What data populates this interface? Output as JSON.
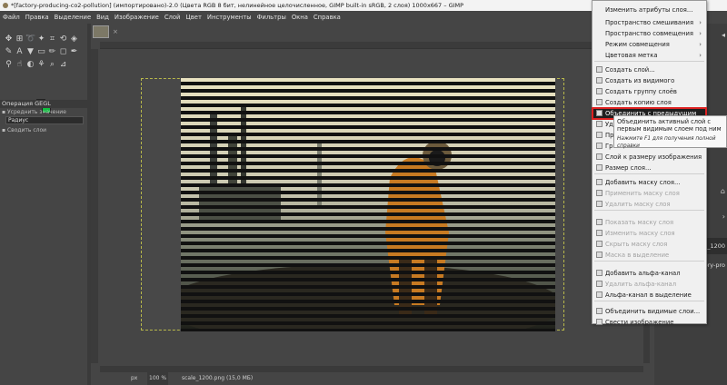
{
  "window": {
    "title": "*[factory-producing-co2-pollution] (импортировано)-2.0 (Цвета RGB 8 бит, нелинейное целочисленное, GIMP built-in sRGB, 2 слоя) 1000x667 – GIMP"
  },
  "menubar": [
    "Файл",
    "Правка",
    "Выделение",
    "Вид",
    "Изображение",
    "Слой",
    "Цвет",
    "Инструменты",
    "Фильтры",
    "Окна",
    "Справка"
  ],
  "tool_options": {
    "title": "Операция GEGL",
    "average_label": "Усреднить значение",
    "radius_value": "Радиус",
    "merge_label": "Сводить слои"
  },
  "image_tab": {
    "close": "×"
  },
  "status": {
    "unit": "px",
    "zoom": "100 %",
    "file": "scale_1200.png (15,0 МБ)"
  },
  "right_dock": {
    "layer1_name": "_1200",
    "layer2_name": "tory-pro"
  },
  "context_menu": {
    "items": [
      {
        "label": "Изменить атрибуты слоя...",
        "disabled": false,
        "submenu": false
      },
      {
        "label": "Пространство смешивания",
        "disabled": false,
        "submenu": true
      },
      {
        "label": "Пространство совмещения",
        "disabled": false,
        "submenu": true
      },
      {
        "label": "Режим совмещения",
        "disabled": false,
        "submenu": true
      },
      {
        "label": "Цветовая метка",
        "disabled": false,
        "submenu": true
      },
      {
        "label": "Создать слой...",
        "disabled": false,
        "submenu": false
      },
      {
        "label": "Создать из видимого",
        "disabled": false,
        "submenu": false
      },
      {
        "label": "Создать группу слоёв",
        "disabled": false,
        "submenu": false
      },
      {
        "label": "Создать копию слоя",
        "disabled": false,
        "submenu": false
      },
      {
        "label": "Объединить с предыдущим",
        "disabled": false,
        "submenu": false
      },
      {
        "label": "Уда",
        "disabled": false,
        "submenu": false
      },
      {
        "label": "Пр",
        "disabled": false,
        "submenu": false
      },
      {
        "label": "Гра",
        "disabled": false,
        "submenu": false
      },
      {
        "label": "Слой к размеру изображения",
        "disabled": false,
        "submenu": false
      },
      {
        "label": "Размер слоя...",
        "disabled": false,
        "submenu": false
      },
      {
        "label": "Добавить маску слоя...",
        "disabled": false,
        "submenu": false
      },
      {
        "label": "Применить маску слоя",
        "disabled": true,
        "submenu": false
      },
      {
        "label": "Удалить маску слоя",
        "disabled": true,
        "submenu": false
      },
      {
        "label": "Показать маску слоя",
        "disabled": true,
        "submenu": false
      },
      {
        "label": "Изменить маску слоя",
        "disabled": true,
        "submenu": false
      },
      {
        "label": "Скрыть маску слоя",
        "disabled": true,
        "submenu": false
      },
      {
        "label": "Маска в выделение",
        "disabled": true,
        "submenu": false
      },
      {
        "label": "Добавить альфа-канал",
        "disabled": false,
        "submenu": false
      },
      {
        "label": "Удалить альфа-канал",
        "disabled": true,
        "submenu": false
      },
      {
        "label": "Альфа-канал в выделение",
        "disabled": false,
        "submenu": false
      },
      {
        "label": "Объединить видимые слои...",
        "disabled": false,
        "submenu": false
      },
      {
        "label": "Свести изображение",
        "disabled": false,
        "submenu": false
      }
    ]
  },
  "tooltip": {
    "text": "Объединить активный слой с первым видимым слоем под ним",
    "hint": "Нажмите F1 для получения полной справки"
  }
}
